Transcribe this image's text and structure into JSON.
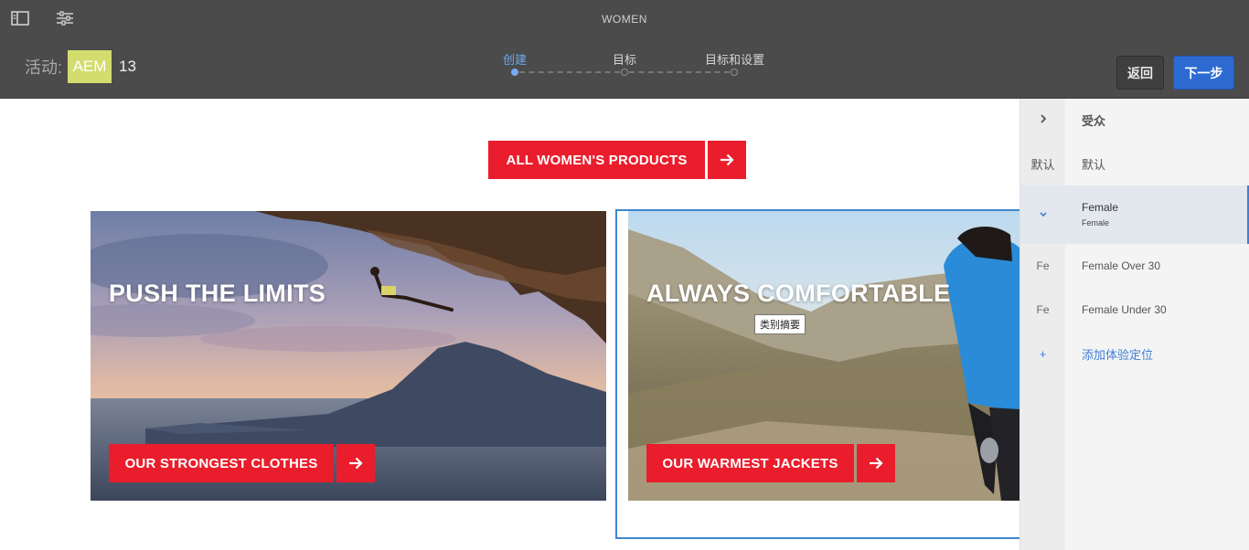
{
  "header": {
    "title": "WOMEN",
    "activity_label": "活动:",
    "activity_badge": "AEM",
    "activity_number": "13",
    "steps": [
      {
        "label": "创建",
        "active": true
      },
      {
        "label": "目标",
        "active": false
      },
      {
        "label": "目标和设置",
        "active": false
      }
    ],
    "back_label": "返回",
    "next_label": "下一步"
  },
  "content": {
    "top_cta": "ALL WOMEN'S PRODUCTS",
    "cards": [
      {
        "title": "PUSH THE LIMITS",
        "cta": "OUR STRONGEST CLOTHES"
      },
      {
        "title": "ALWAYS COMFORTABLE",
        "cta": "OUR WARMEST JACKETS"
      }
    ],
    "tooltip": "类别摘要"
  },
  "panel": {
    "header_label": "受众",
    "default_gutter": "默认",
    "default_label": "默认",
    "female_label": "Female",
    "female_sub": "Female",
    "over30_gutter": "Fe",
    "over30_label": "Female Over 30",
    "under30_gutter": "Fe",
    "under30_label": "Female Under 30",
    "add_gutter": "+",
    "add_label": "添加体验定位"
  },
  "colors": {
    "header_bg": "#4b4b4b",
    "accent_blue": "#2d6bd2",
    "brand_red": "#ea1d2c",
    "activity_badge": "#d2dd6e"
  },
  "icons": [
    "sidebar-toggle-icon",
    "properties-icon",
    "arrow-right-icon",
    "chevron-right-icon",
    "chevron-down-icon",
    "plus-icon"
  ]
}
